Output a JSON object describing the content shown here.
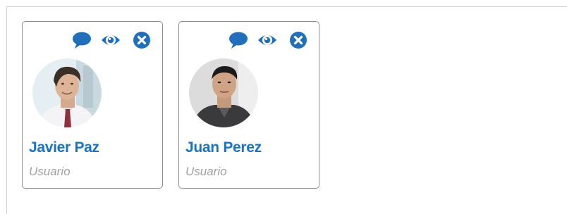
{
  "colors": {
    "accent": "#1a73c1",
    "icon": "#1f6fbb",
    "role_text": "#a0a0a0",
    "card_border": "#8e8e8e"
  },
  "users": [
    {
      "name": "Javier Paz",
      "role": "Usuario",
      "actions": [
        "chat-bubble-icon",
        "eye-icon",
        "close-icon"
      ]
    },
    {
      "name": "Juan Perez",
      "role": "Usuario",
      "actions": [
        "chat-bubble-icon",
        "eye-icon",
        "close-icon"
      ]
    }
  ]
}
